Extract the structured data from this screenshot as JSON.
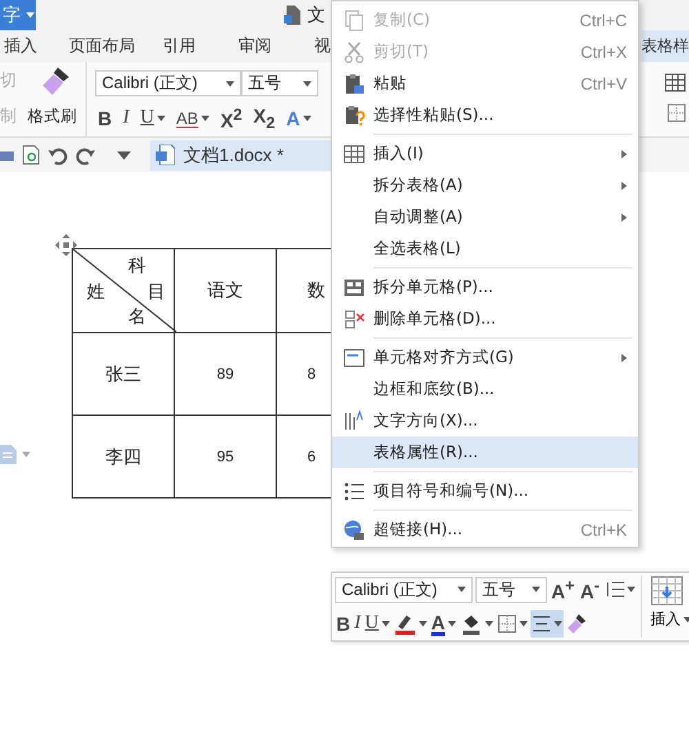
{
  "title_bar": {
    "app_button": "字",
    "doc_title": "文"
  },
  "tabs": [
    {
      "label": "插入",
      "selected": false
    },
    {
      "label": "页面布局",
      "selected": false
    },
    {
      "label": "引用",
      "selected": false
    },
    {
      "label": "审阅",
      "selected": false
    },
    {
      "label": "视",
      "selected": false
    },
    {
      "label": "表格样",
      "selected": true
    }
  ],
  "clipboard": {
    "cut": "切",
    "copy": "制",
    "format_painter": "格式刷"
  },
  "font": {
    "name": "Calibri (正文)",
    "size": "五号"
  },
  "format_buttons": [
    {
      "kind": "bold",
      "label": "B",
      "menu": false
    },
    {
      "kind": "italic",
      "label": "I",
      "menu": false
    },
    {
      "kind": "underline",
      "label": "U",
      "menu": true
    },
    {
      "kind": "strike",
      "label": "AB",
      "menu": true
    },
    {
      "kind": "script",
      "label": "X$^{2}$",
      "menu": false
    },
    {
      "kind": "script",
      "label": "X$_{2}$",
      "menu": false
    },
    {
      "kind": "outline",
      "label": "A",
      "menu": true
    }
  ],
  "doc_tab": {
    "label": "文档1.docx *"
  },
  "table": {
    "corner": {
      "top": "科",
      "right": "目",
      "left": "姓",
      "bottom": "名"
    },
    "columns": [
      "语文",
      "数"
    ],
    "rows": [
      {
        "name": "张三",
        "cells": [
          "89",
          "8"
        ]
      },
      {
        "name": "李四",
        "cells": [
          "95",
          "6"
        ]
      }
    ]
  },
  "context_menu": {
    "groups": [
      [
        {
          "kind": "copy",
          "label": "复制(C)",
          "shortcut": "Ctrl+C",
          "disabled": true,
          "submenu": false,
          "selected": false
        },
        {
          "kind": "cut",
          "label": "剪切(T)",
          "shortcut": "Ctrl+X",
          "disabled": true,
          "submenu": false,
          "selected": false
        },
        {
          "kind": "paste",
          "label": "粘贴",
          "shortcut": "Ctrl+V",
          "disabled": false,
          "submenu": false,
          "selected": false
        },
        {
          "kind": "paste-special",
          "label": "选择性粘贴(S)...",
          "disabled": false,
          "submenu": false,
          "selected": false
        }
      ],
      [
        {
          "kind": "table",
          "label": "插入(I)",
          "disabled": false,
          "submenu": true,
          "selected": false
        },
        {
          "kind": "plain",
          "label": "拆分表格(A)",
          "disabled": false,
          "submenu": true,
          "selected": false
        },
        {
          "kind": "plain",
          "label": "自动调整(A)",
          "disabled": false,
          "submenu": true,
          "selected": false
        },
        {
          "kind": "plain",
          "label": "全选表格(L)",
          "disabled": false,
          "submenu": false,
          "selected": false
        }
      ],
      [
        {
          "kind": "split-cells",
          "label": "拆分单元格(P)...",
          "disabled": false,
          "submenu": false,
          "selected": false
        },
        {
          "kind": "delete-cells",
          "label": "删除单元格(D)...",
          "disabled": false,
          "submenu": false,
          "selected": false
        }
      ],
      [
        {
          "kind": "align",
          "label": "单元格对齐方式(G)",
          "disabled": false,
          "submenu": true,
          "selected": false
        },
        {
          "kind": "plain",
          "label": "边框和底纹(B)...",
          "disabled": false,
          "submenu": false,
          "selected": false
        },
        {
          "kind": "text-direction",
          "label": "文字方向(X)...",
          "disabled": false,
          "submenu": false,
          "selected": false
        },
        {
          "kind": "plain",
          "label": "表格属性(R)...",
          "disabled": false,
          "submenu": false,
          "selected": true
        }
      ],
      [
        {
          "kind": "bullets",
          "label": "项目符号和编号(N)...",
          "disabled": false,
          "submenu": false,
          "selected": false
        }
      ],
      [
        {
          "kind": "globe",
          "label": "超链接(H)...",
          "shortcut": "Ctrl+K",
          "disabled": false,
          "submenu": false,
          "selected": false
        }
      ]
    ]
  },
  "mini_toolbar": {
    "font": "Calibri (正文)",
    "size": "五号",
    "top_buttons": [
      {
        "kind": "grow",
        "label": "A$^{+}$",
        "menu": false
      },
      {
        "kind": "grow",
        "label": "A$^{-}$",
        "menu": false
      },
      {
        "kind": "spacing",
        "menu": true
      }
    ],
    "buttons": [
      {
        "kind": "bold",
        "label": "B",
        "menu": false,
        "selected": false
      },
      {
        "kind": "italic",
        "label": "I",
        "menu": false,
        "selected": false
      },
      {
        "kind": "underline",
        "label": "U",
        "menu": true,
        "selected": false
      },
      {
        "kind": "highlight",
        "color": "#e02020",
        "menu": true,
        "selected": false
      },
      {
        "kind": "color-text",
        "label": "A",
        "color": "#1a2fd6",
        "menu": true,
        "selected": false
      },
      {
        "kind": "fill",
        "menu": true,
        "selected": false
      },
      {
        "kind": "border",
        "menu": true,
        "selected": false
      },
      {
        "kind": "align",
        "menu": true,
        "selected": true
      },
      {
        "kind": "brush",
        "menu": false,
        "selected": false
      }
    ],
    "insert_button": "插入"
  }
}
